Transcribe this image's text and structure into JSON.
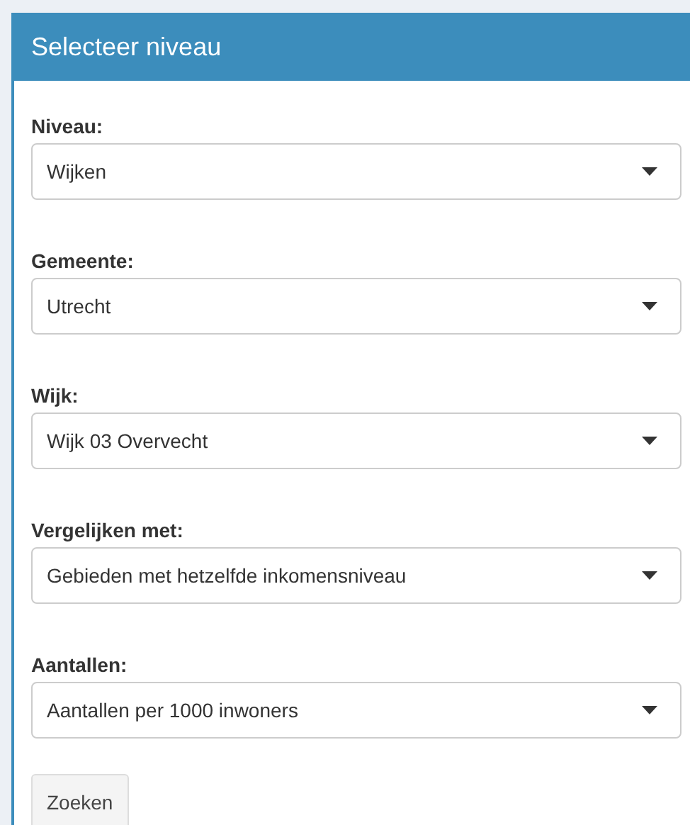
{
  "panel": {
    "title": "Selecteer niveau"
  },
  "fields": [
    {
      "label": "Niveau:",
      "value": "Wijken"
    },
    {
      "label": "Gemeente:",
      "value": "Utrecht"
    },
    {
      "label": "Wijk:",
      "value": "Wijk 03 Overvecht"
    },
    {
      "label": "Vergelijken met:",
      "value": "Gebieden met hetzelfde inkomensniveau"
    },
    {
      "label": "Aantallen:",
      "value": "Aantallen per 1000 inwoners"
    }
  ],
  "button": "Zoeken"
}
